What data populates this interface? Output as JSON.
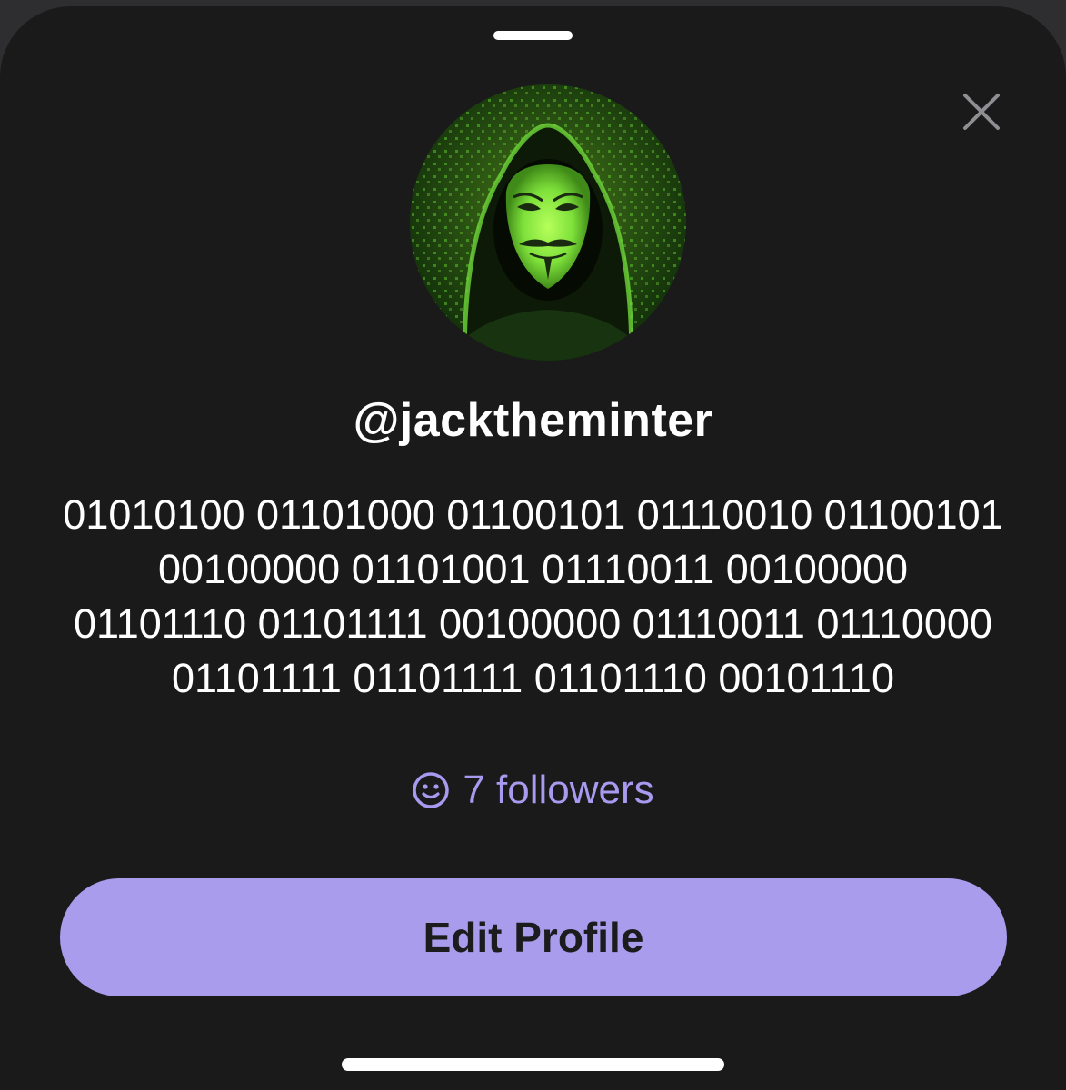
{
  "profile": {
    "username": "@jacktheminter",
    "bio_lines": [
      "01010100 01101000 01100101 01110010 01100101",
      "00100000 01101001 01110011 00100000",
      "01101110 01101111 00100000 01110011 01110000",
      "01101111 01101111 01101110 00101110"
    ],
    "followers_label": "7 followers",
    "avatar_description_icon": "hooded-mask-avatar"
  },
  "actions": {
    "edit_profile_label": "Edit Profile",
    "close_icon": "close-icon"
  },
  "colors": {
    "sheet_background": "#1a1a1b",
    "accent": "#a99cec",
    "followers_text": "#a99af0",
    "button_text": "#1c1c1e"
  }
}
